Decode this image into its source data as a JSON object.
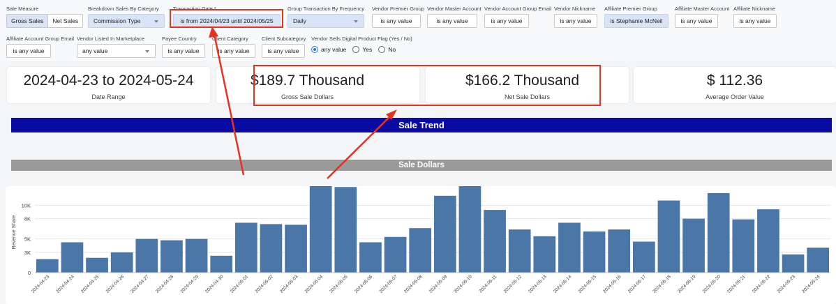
{
  "filters": {
    "sale_measure": {
      "label": "Sale Measure",
      "options": [
        "Gross Sales",
        "Net Sales"
      ],
      "selected": "Gross Sales"
    },
    "breakdown": {
      "label": "Breakdown Sales By Category",
      "value": "Commission Type"
    },
    "transaction_date": {
      "label": "Transaction Date *",
      "value": "is from 2024/04/23 until 2024/05/25"
    },
    "group_frequency": {
      "label": "Group Transaction By Frequency",
      "value": "Daily"
    },
    "vendor_premier_group": {
      "label": "Vendor Premier Group",
      "value": "is any value"
    },
    "vendor_master_account": {
      "label": "Vendor Master Account",
      "value": "is any value"
    },
    "vendor_account_group_email": {
      "label": "Vendor Account Group Email",
      "value": "is any value"
    },
    "vendor_nickname": {
      "label": "Vendor Nickname",
      "value": "is any value"
    },
    "affiliate_premier_group": {
      "label": "Affiliate Premier Group",
      "value": "is Stephanie McNeil"
    },
    "affiliate_master_account": {
      "label": "Affiliate Master Account",
      "value": "is any value"
    },
    "affiliate_nickname": {
      "label": "Affiliate Nickname",
      "value": "is any value"
    },
    "affiliate_account_group_email": {
      "label": "Affiliate Account Group Email",
      "value": "is any value"
    },
    "vendor_listed_marketplace": {
      "label": "Vendor Listed In Marketplace",
      "value": "any value"
    },
    "payee_country": {
      "label": "Payee Country",
      "value": "is any value"
    },
    "client_category": {
      "label": "Client Category",
      "value": "is any value"
    },
    "client_subcategory": {
      "label": "Client Subcategory",
      "value": "is any value"
    },
    "digital_flag": {
      "label": "Vendor Sells Digital Product Flag (Yes / No)",
      "options": [
        "any value",
        "Yes",
        "No"
      ],
      "selected": "any value"
    }
  },
  "scorecards": [
    {
      "value": "2024-04-23 to 2024-05-24",
      "caption": "Date Range"
    },
    {
      "value": "$189.7 Thousand",
      "caption": "Gross Sale Dollars"
    },
    {
      "value": "$166.2 Thousand",
      "caption": "Net Sale Dollars"
    },
    {
      "value": "$ 112.36",
      "caption": "Average Order Value"
    }
  ],
  "banners": {
    "trend": "Sale Trend",
    "dollars": "Sale Dollars"
  },
  "chart_data": {
    "type": "bar",
    "title": "",
    "xlabel": "",
    "ylabel": "Revenue Share",
    "ylim": [
      0,
      12000
    ],
    "yticks": [
      0,
      3000,
      5000,
      8000,
      10000
    ],
    "ytick_labels": [
      "0",
      "3K",
      "5K",
      "8K",
      "10K"
    ],
    "grid": true,
    "bar_color": "#4a76a8",
    "categories": [
      "2024-04-23",
      "2024-04-24",
      "2024-04-25",
      "2024-04-26",
      "2024-04-27",
      "2024-04-28",
      "2024-04-29",
      "2024-04-30",
      "2024-05-01",
      "2024-05-02",
      "2024-05-03",
      "2024-05-04",
      "2024-05-05",
      "2024-05-06",
      "2024-05-07",
      "2024-05-08",
      "2024-05-09",
      "2024-05-10",
      "2024-05-11",
      "2024-05-12",
      "2024-05-13",
      "2024-05-14",
      "2024-05-15",
      "2024-05-16",
      "2024-05-17",
      "2024-05-18",
      "2024-05-19",
      "2024-05-20",
      "2024-05-21",
      "2024-05-22",
      "2024-05-23",
      "2024-05-24"
    ],
    "values": [
      2000,
      4500,
      2200,
      3000,
      5000,
      4800,
      5000,
      2500,
      7400,
      7200,
      7100,
      13400,
      12700,
      4500,
      5300,
      6600,
      11400,
      14300,
      9300,
      6400,
      5400,
      7400,
      6100,
      6400,
      4600,
      10700,
      8000,
      11800,
      7900,
      9400,
      2700,
      3700
    ]
  },
  "annotation_color": "#e8311f"
}
